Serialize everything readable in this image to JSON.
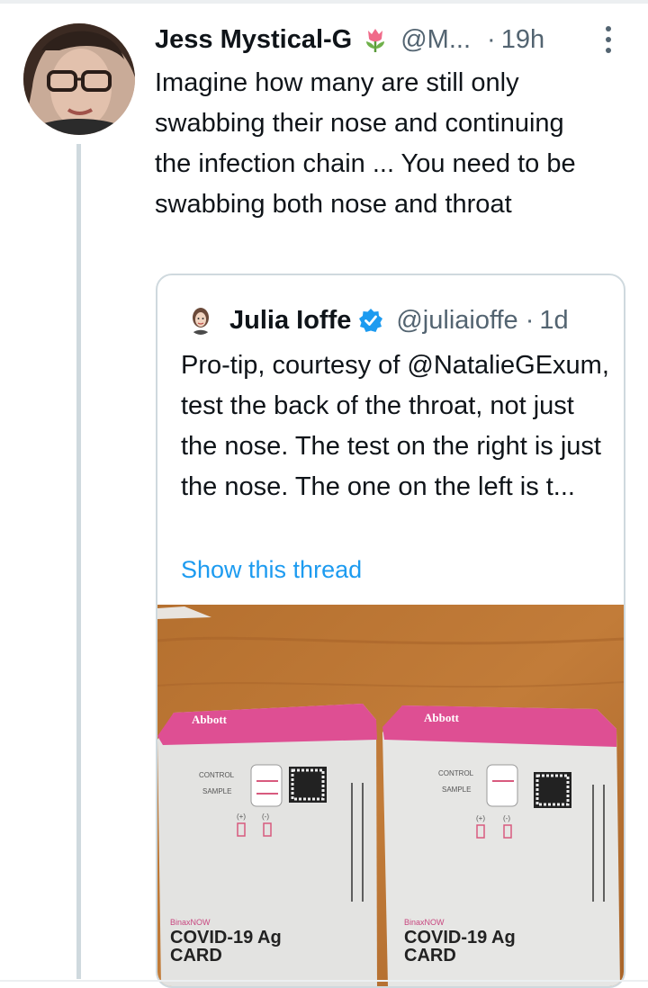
{
  "tweet": {
    "author_name": "Jess Mystical-G",
    "author_handle": "@M...",
    "separator": "·",
    "time": "19h",
    "text": "Imagine how many are still only swabbing their nose and continuing the infection chain ... You need to be swabbing both nose and throat",
    "emoji_icon": "tulip-icon"
  },
  "quoted_tweet": {
    "author_name": "Julia Ioffe",
    "author_handle": "@juliaioffe",
    "separator": "·",
    "time": "1d",
    "text": "Pro-tip, courtesy of @NatalieGExum, test the back of the throat, not just the nose. The test on the right is just the nose. The one on the left is t...",
    "show_thread": "Show this thread",
    "verified_color": "#1d9bf0"
  },
  "photo": {
    "card_brand": "Abbott",
    "card_control": "CONTROL",
    "card_sample": "SAMPLE",
    "card_plus": "(+)",
    "card_minus": "(-)",
    "card_product_small": "BinaxNOW",
    "card_product": "COVID-19 Ag",
    "card_product2": "CARD"
  }
}
